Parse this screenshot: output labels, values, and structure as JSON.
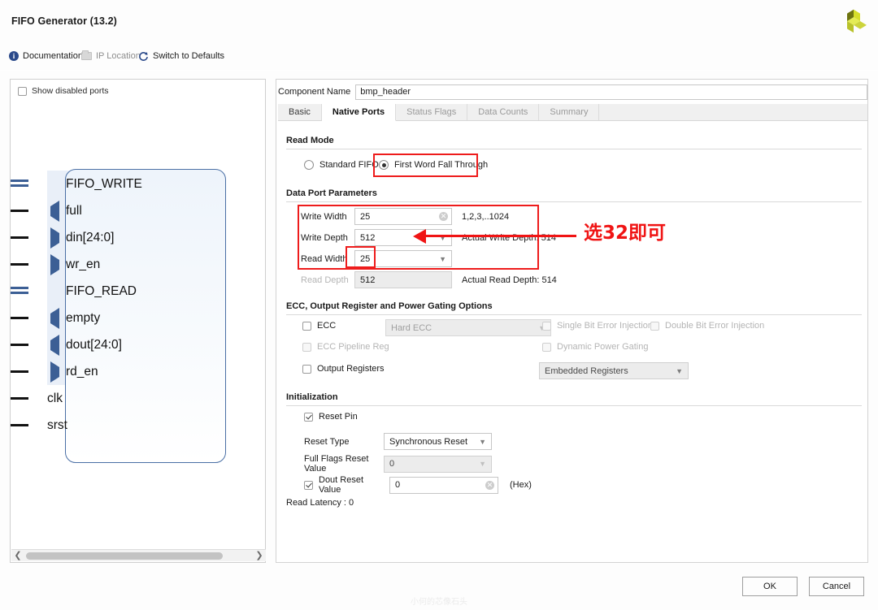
{
  "window": {
    "title": "FIFO Generator (13.2)",
    "logo_icon": "xilinx-logo"
  },
  "toolbar": {
    "documentation": "Documentation",
    "ip_location": "IP Location",
    "switch_to_defaults": "Switch to Defaults",
    "info_icon": "info-icon",
    "folder_icon": "folder-icon",
    "refresh_icon": "refresh-icon"
  },
  "left_panel": {
    "show_disabled_ports": "Show disabled ports",
    "show_disabled_ports_checked": false,
    "ports": [
      {
        "label": "FIFO_WRITE",
        "glyph": "bus-dash",
        "group": true
      },
      {
        "label": "full",
        "glyph": "arrow-left",
        "group": true
      },
      {
        "label": "din[24:0]",
        "glyph": "arrow-right",
        "group": true
      },
      {
        "label": "wr_en",
        "glyph": "arrow-right",
        "group": true
      },
      {
        "label": "FIFO_READ",
        "glyph": "bus-dash",
        "group": true
      },
      {
        "label": "empty",
        "glyph": "arrow-left",
        "group": true
      },
      {
        "label": "dout[24:0]",
        "glyph": "arrow-left",
        "group": true
      },
      {
        "label": "rd_en",
        "glyph": "arrow-right",
        "group": true
      },
      {
        "label": "clk",
        "glyph": "none",
        "group": false
      },
      {
        "label": "srst",
        "glyph": "none",
        "group": false
      }
    ],
    "scroll_left_icon": "chevron-left-icon",
    "scroll_right_icon": "chevron-right-icon"
  },
  "component": {
    "label": "Component Name",
    "value": "bmp_header"
  },
  "tabs": [
    {
      "label": "Basic",
      "state": "enabled"
    },
    {
      "label": "Native Ports",
      "state": "active"
    },
    {
      "label": "Status Flags",
      "state": "disabled"
    },
    {
      "label": "Data Counts",
      "state": "disabled"
    },
    {
      "label": "Summary",
      "state": "disabled"
    }
  ],
  "read_mode": {
    "title": "Read Mode",
    "options": [
      {
        "label": "Standard FIFO",
        "selected": false
      },
      {
        "label": "First Word Fall Through",
        "selected": true
      }
    ]
  },
  "data_port": {
    "title": "Data Port Parameters",
    "write_width_label": "Write Width",
    "write_width_value": "25",
    "write_width_hint": "1,2,3,..1024",
    "write_depth_label": "Write Depth",
    "write_depth_value": "512",
    "actual_write_depth": "Actual Write Depth: 514",
    "read_width_label": "Read Width",
    "read_width_value": "25",
    "read_depth_label": "Read Depth",
    "read_depth_value": "512",
    "actual_read_depth": "Actual Read Depth: 514",
    "clear_icon": "clear-field-icon",
    "chevron_icon": "chevron-down-icon"
  },
  "ecc": {
    "title": "ECC, Output Register and Power Gating Options",
    "ecc_label": "ECC",
    "ecc_checked": false,
    "ecc_mode_value": "Hard ECC",
    "single_bit_label": "Single Bit Error Injection",
    "single_bit_checked": false,
    "double_bit_label": "Double Bit Error Injection",
    "double_bit_checked": false,
    "pipeline_label": "ECC Pipeline Reg",
    "pipeline_checked": false,
    "dyn_power_label": "Dynamic Power Gating",
    "dyn_power_checked": false,
    "output_reg_label": "Output Registers",
    "output_reg_checked": false,
    "output_reg_value": "Embedded Registers"
  },
  "initialization": {
    "title": "Initialization",
    "reset_pin_label": "Reset Pin",
    "reset_pin_checked": true,
    "reset_type_label": "Reset Type",
    "reset_type_value": "Synchronous Reset",
    "full_flags_label": "Full Flags Reset Value",
    "full_flags_value": "0",
    "dout_reset_label": "Dout Reset Value",
    "dout_reset_checked": true,
    "dout_reset_value": "0",
    "hex_suffix": "(Hex)",
    "read_latency": "Read Latency : 0"
  },
  "annotations": {
    "note_text": "选32即可",
    "color": "#f01414"
  },
  "footer": {
    "ok": "OK",
    "cancel": "Cancel"
  },
  "watermark": "小何的芯像石头"
}
